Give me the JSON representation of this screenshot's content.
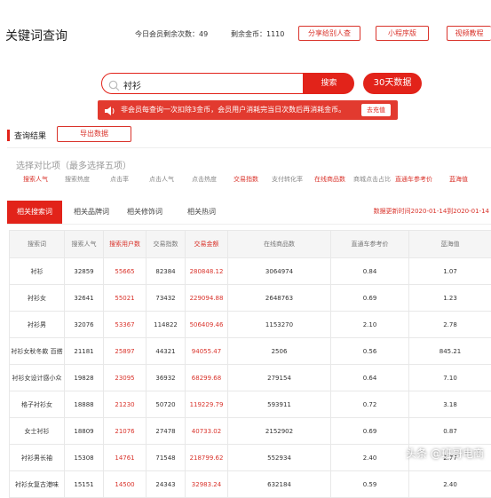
{
  "header": {
    "title": "关键词查询",
    "member_queries": "今日会员剩余次数：49",
    "coins": "剩余金币：1110",
    "share_btn": "分享给别人查",
    "miniprogram_btn": "小程序版",
    "video_btn": "视频教程"
  },
  "search": {
    "value": "衬衫",
    "button": "搜索",
    "days_button": "30天数据"
  },
  "notice": {
    "text": "非会员每查询一次扣除3金币，会员用户消耗完当日次数后再消耗金币。",
    "button": "去充值"
  },
  "results": {
    "title": "查询结果",
    "export_btn": "导出数据"
  },
  "compare": {
    "label": "选择对比项（最多选择五项）",
    "items": [
      {
        "label": "搜索人气",
        "selected": true
      },
      {
        "label": "搜索热度",
        "selected": false
      },
      {
        "label": "点击率",
        "selected": false
      },
      {
        "label": "点击人气",
        "selected": false
      },
      {
        "label": "点击热度",
        "selected": false
      },
      {
        "label": "交易指数",
        "selected": true
      },
      {
        "label": "支付转化率",
        "selected": false
      },
      {
        "label": "在线商品数",
        "selected": true
      },
      {
        "label": "商城点击占比",
        "selected": false
      },
      {
        "label": "直通车参考价",
        "selected": true
      },
      {
        "label": "蓝海值",
        "selected": true
      }
    ]
  },
  "tabs": [
    "相关搜索词",
    "相关品牌词",
    "相关修饰词",
    "相关热词"
  ],
  "update_time": "数据更新时间2020-01-14到2020-01-14",
  "table": {
    "headers": [
      "搜索词",
      "搜索人气",
      "搜索用户数",
      "交易指数",
      "交易金额",
      "在线商品数",
      "直通车参考价",
      "蓝海值"
    ],
    "rows": [
      [
        "衬衫",
        "32859",
        "55665",
        "82384",
        "280848.12",
        "3064974",
        "0.84",
        "1.07"
      ],
      [
        "衬衫女",
        "32641",
        "55021",
        "73432",
        "229094.88",
        "2648763",
        "0.69",
        "1.23"
      ],
      [
        "衬衫男",
        "32076",
        "53367",
        "114822",
        "506409.46",
        "1153270",
        "2.10",
        "2.78"
      ],
      [
        "衬衫女秋冬款 百搭",
        "21181",
        "25897",
        "44321",
        "94055.47",
        "2506",
        "0.56",
        "845.21"
      ],
      [
        "衬衫女设计感小众",
        "19828",
        "23095",
        "36932",
        "68299.68",
        "279154",
        "0.64",
        "7.10"
      ],
      [
        "格子衬衫女",
        "18888",
        "21230",
        "50720",
        "119229.79",
        "593911",
        "0.72",
        "3.18"
      ],
      [
        "女士衬衫",
        "18809",
        "21076",
        "27478",
        "40733.02",
        "2152902",
        "0.69",
        "0.87"
      ],
      [
        "衬衫男长袖",
        "15308",
        "14761",
        "71548",
        "218799.62",
        "552934",
        "2.40",
        "2.77"
      ],
      [
        "衬衫女复古港味",
        "15151",
        "14500",
        "24343",
        "32983.24",
        "632184",
        "0.59",
        "2.40"
      ]
    ]
  },
  "watermark": "头条 @班哥电商"
}
